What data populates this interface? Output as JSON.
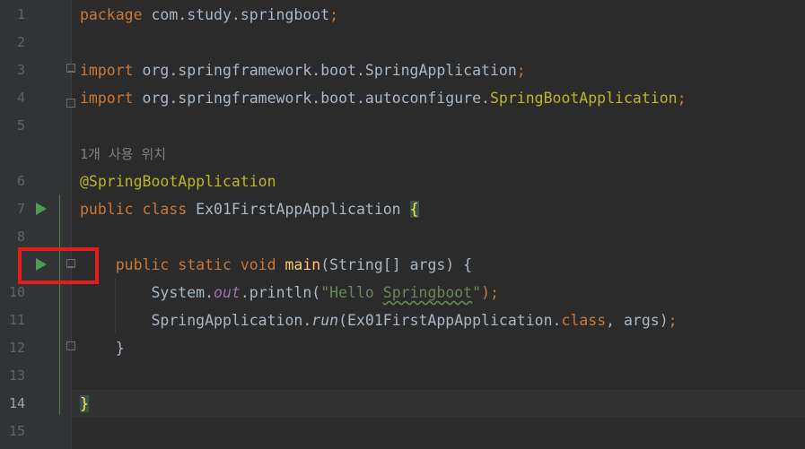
{
  "editor": {
    "lines": [
      {
        "num": "1",
        "tokens": [
          {
            "t": "package ",
            "c": "kw"
          },
          {
            "t": "com.study.springboot"
          },
          {
            "t": ";",
            "c": "kw"
          }
        ]
      },
      {
        "num": "2",
        "tokens": []
      },
      {
        "num": "3",
        "tokens": [
          {
            "t": "import ",
            "c": "kw"
          },
          {
            "t": "org.springframework.boot.SpringApplication"
          },
          {
            "t": ";",
            "c": "kw"
          }
        ]
      },
      {
        "num": "4",
        "tokens": [
          {
            "t": "import ",
            "c": "kw"
          },
          {
            "t": "org.springframework.boot.autoconfigure."
          },
          {
            "t": "SpringBootApplication",
            "c": "ann"
          },
          {
            "t": ";",
            "c": "kw"
          }
        ]
      },
      {
        "num": "5",
        "tokens": []
      },
      {
        "num": "",
        "tokens": [
          {
            "t": "1개 사용 위치",
            "c": "hint"
          }
        ]
      },
      {
        "num": "6",
        "tokens": [
          {
            "t": "@SpringBootApplication",
            "c": "ann"
          }
        ]
      },
      {
        "num": "7",
        "tokens": [
          {
            "t": "public class ",
            "c": "kw"
          },
          {
            "t": "Ex01FirstAppApplication "
          },
          {
            "t": "{",
            "c": "brace-hl"
          }
        ]
      },
      {
        "num": "8",
        "tokens": []
      },
      {
        "num": "",
        "tokens": [
          {
            "t": "    public static void ",
            "c": "kw"
          },
          {
            "t": "main",
            "c": "fn"
          },
          {
            "t": "(String[] args) {"
          }
        ]
      },
      {
        "num": "10",
        "tokens": [
          {
            "t": "        System."
          },
          {
            "t": "out",
            "c": "field"
          },
          {
            "t": ".println("
          },
          {
            "t": "\"Hello ",
            "c": "str"
          },
          {
            "t": "Springboot",
            "c": "str squiggle"
          },
          {
            "t": "\"",
            "c": "str"
          },
          {
            "t": ");",
            "c": "kw"
          }
        ]
      },
      {
        "num": "11",
        "tokens": [
          {
            "t": "        SpringApplication."
          },
          {
            "t": "run",
            "c": "italic"
          },
          {
            "t": "(Ex01FirstAppApplication."
          },
          {
            "t": "class",
            "c": "kw"
          },
          {
            "t": ", args)"
          },
          {
            "t": ";",
            "c": "kw"
          }
        ]
      },
      {
        "num": "12",
        "tokens": [
          {
            "t": "    }"
          }
        ]
      },
      {
        "num": "13",
        "tokens": []
      },
      {
        "num": "14",
        "tokens": [
          {
            "t": "}",
            "c": "brace-hl"
          }
        ],
        "active": true
      },
      {
        "num": "15",
        "tokens": []
      }
    ]
  },
  "colors": {
    "background": "#2b2b2b",
    "keyword": "#cc7832",
    "annotation": "#bbb529",
    "string": "#6a8759",
    "run_icon": "#499c54",
    "highlight_box": "#e11d1d"
  }
}
